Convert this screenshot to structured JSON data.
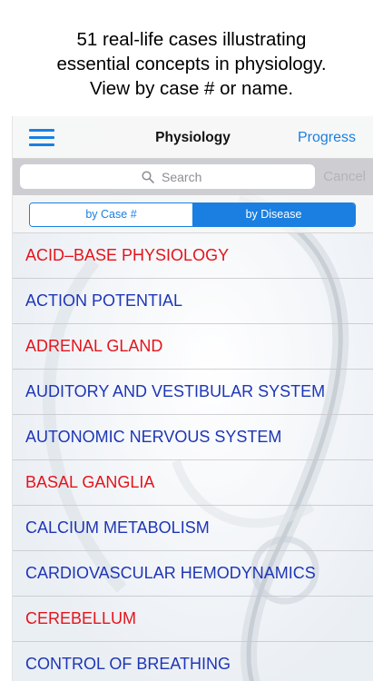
{
  "caption": {
    "line1": "51 real-life cases illustrating",
    "line2": "essential concepts in physiology.",
    "line3": "View by case # or name."
  },
  "navbar": {
    "title": "Physiology",
    "progress_label": "Progress"
  },
  "search": {
    "placeholder": "Search",
    "cancel_label": "Cancel"
  },
  "segments": {
    "by_case": "by Case #",
    "by_disease": "by Disease",
    "selected": "by Disease"
  },
  "colors": {
    "accent": "#1a7fe0",
    "red_item": "#e4141b",
    "blue_item": "#1e36b5"
  },
  "topics": [
    {
      "label": "ACID–BASE PHYSIOLOGY",
      "color": "red"
    },
    {
      "label": "ACTION POTENTIAL",
      "color": "blue"
    },
    {
      "label": "ADRENAL GLAND",
      "color": "red"
    },
    {
      "label": "AUDITORY AND VESTIBULAR SYSTEM",
      "color": "blue"
    },
    {
      "label": "AUTONOMIC NERVOUS SYSTEM",
      "color": "blue"
    },
    {
      "label": "BASAL GANGLIA",
      "color": "red"
    },
    {
      "label": "CALCIUM METABOLISM",
      "color": "blue"
    },
    {
      "label": "CARDIOVASCULAR HEMODYNAMICS",
      "color": "blue"
    },
    {
      "label": "CEREBELLUM",
      "color": "red"
    },
    {
      "label": "CONTROL OF BREATHING",
      "color": "blue"
    }
  ]
}
